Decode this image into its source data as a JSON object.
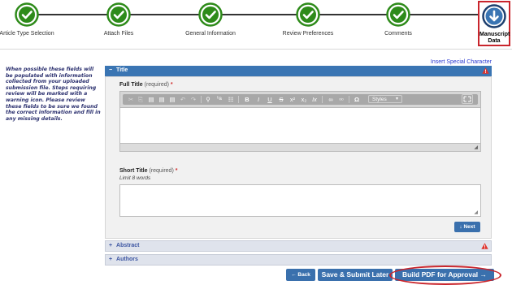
{
  "steps": [
    {
      "label": "Article Type Selection",
      "state": "complete"
    },
    {
      "label": "Attach Files",
      "state": "complete"
    },
    {
      "label": "General Information",
      "state": "complete"
    },
    {
      "label": "Review Preferences",
      "state": "complete"
    },
    {
      "label": "Comments",
      "state": "complete"
    },
    {
      "label": "Manuscript Data",
      "state": "current"
    }
  ],
  "help_text": "When possible these fields will be populated with information collected from your uploaded submission file. Steps requiring review will be marked with a warning icon. Please review these fields to be sure we found the correct information and fill in any missing details.",
  "insert_special_character": "Insert Special Character",
  "title_section": {
    "toggle": "−",
    "label": "Title",
    "full_title": {
      "label": "Full Title",
      "required": "(required)",
      "star": "*"
    },
    "short_title": {
      "label": "Short Title",
      "required": "(required)",
      "star": "*",
      "hint": "Limit 8 words"
    },
    "styles_label": "Styles",
    "next_label": "Next",
    "next_icon": "↓"
  },
  "toolbar_icons": [
    "cut-icon",
    "copy-icon",
    "paste-icon",
    "paste-text-icon",
    "paste-word-icon",
    "undo-icon",
    "redo-icon",
    "find-icon",
    "replace-icon",
    "select-all-icon",
    "bold-icon",
    "italic-icon",
    "underline-icon",
    "strikethrough-icon",
    "superscript-icon",
    "subscript-icon",
    "remove-format-icon",
    "link-icon",
    "unlink-icon",
    "special-char-icon",
    "maximize-icon"
  ],
  "collapsed_sections": [
    {
      "toggle": "+",
      "label": "Abstract",
      "warning": true
    },
    {
      "toggle": "+",
      "label": "Authors",
      "warning": false
    }
  ],
  "buttons": {
    "back": "Back",
    "back_icon": "←",
    "save": "Save & Submit Later",
    "build_pdf": "Build PDF for Approval",
    "build_pdf_icon": "→"
  },
  "colors": {
    "complete": "#2e8b1a",
    "current": "#3a75b3",
    "header": "#3a75b3",
    "highlight": "#c9252c"
  }
}
